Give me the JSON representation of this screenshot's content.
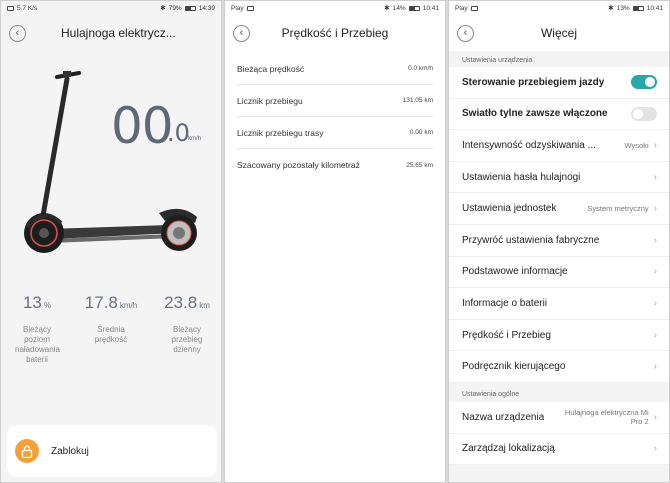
{
  "status_bars": [
    {
      "left": "5.7 K/s",
      "right": "79%",
      "time": "14:39"
    },
    {
      "left": "Play",
      "right": "14%",
      "time": "10:41"
    },
    {
      "left": "Play",
      "right": "13%",
      "time": "10:41"
    }
  ],
  "panel1": {
    "title": "Hulajnoga elektrycz...",
    "speed_int": "00",
    "speed_dec": ".0",
    "speed_unit": "km/h",
    "stats": [
      {
        "value": "13",
        "unit": "%",
        "label": "Bieżący poziom naładowania baterii"
      },
      {
        "value": "17.8",
        "unit": "km/h",
        "label": "Średnia prędkość"
      },
      {
        "value": "23.8",
        "unit": "km",
        "label": "Bieżący przebieg dzienny"
      }
    ],
    "lock_label": "Zablokuj"
  },
  "panel2": {
    "title": "Prędkość i Przebieg",
    "rows": [
      {
        "key": "Bieżąca prędkość",
        "value": "0.0 km/h"
      },
      {
        "key": "Licznik przebiegu",
        "value": "131.05 km"
      },
      {
        "key": "Licznik przebiegu trasy",
        "value": "0.00 km"
      },
      {
        "key": "Szacowany pozostały kilometraż",
        "value": "25.65 km"
      }
    ]
  },
  "panel3": {
    "title": "Więcej",
    "section1": "Ustawienia urządzenia",
    "items1": [
      {
        "label": "Sterowanie przebiegiem jazdy",
        "type": "toggle",
        "on": true
      },
      {
        "label": "Światło tylne zawsze włączone",
        "type": "toggle",
        "on": false
      },
      {
        "label": "Intensywność odzyskiwania ...",
        "aux": "Wysoki",
        "type": "nav"
      },
      {
        "label": "Ustawienia hasła hulajnogi",
        "type": "nav"
      },
      {
        "label": "Ustawienia jednostek",
        "aux": "System metryczny",
        "type": "nav"
      },
      {
        "label": "Przywróć ustawienia fabryczne",
        "type": "nav"
      },
      {
        "label": "Podstawowe informacje",
        "type": "nav"
      },
      {
        "label": "Informacje o baterii",
        "type": "nav"
      },
      {
        "label": "Prędkość i Przebieg",
        "type": "nav"
      },
      {
        "label": "Podręcznik kierującego",
        "type": "nav"
      }
    ],
    "section2": "Ustawienia ogólne",
    "items2": [
      {
        "label": "Nazwa urządzenia",
        "aux": "Hulajnoga elektryczna Mi Pro 2",
        "type": "nav"
      },
      {
        "label": "Zarządzaj lokalizacją",
        "type": "nav"
      }
    ]
  },
  "colors": {
    "accent_toggle": "#2aa8a8",
    "lock_orange": "#f5a138",
    "speed_text": "#5d6878"
  }
}
